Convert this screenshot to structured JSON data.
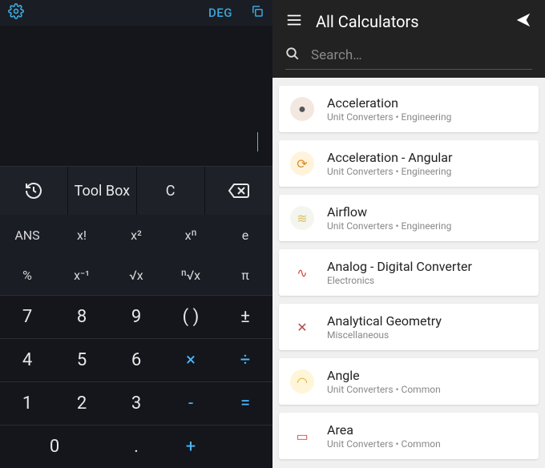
{
  "calc": {
    "mode": "DEG",
    "toolbox": "Tool Box",
    "clear": "C",
    "fn1": [
      "ANS",
      "x!",
      "x²",
      "xⁿ",
      "e"
    ],
    "fn2": [
      "%",
      "x⁻¹",
      "√x",
      "ⁿ√x",
      "π"
    ],
    "row789": [
      "7",
      "8",
      "9",
      "( )",
      "±"
    ],
    "row456": [
      "4",
      "5",
      "6",
      "×",
      "÷"
    ],
    "row123": [
      "1",
      "2",
      "3",
      "-",
      "="
    ],
    "row0": [
      "0",
      ".",
      "+"
    ]
  },
  "list": {
    "title": "All Calculators",
    "search_placeholder": "Search…",
    "items": [
      {
        "title": "Acceleration",
        "sub": "Unit Converters • Engineering",
        "icon": "●",
        "cls": "ic-accel",
        "color": "#555"
      },
      {
        "title": "Acceleration - Angular",
        "sub": "Unit Converters • Engineering",
        "icon": "⟳",
        "cls": "ic-angaccel",
        "color": "#d98c2b"
      },
      {
        "title": "Airflow",
        "sub": "Unit Converters • Engineering",
        "icon": "≋",
        "cls": "ic-airflow",
        "color": "#d4c06a"
      },
      {
        "title": "Analog - Digital Converter",
        "sub": "Electronics",
        "icon": "∿",
        "cls": "ic-analog",
        "color": "#d64545"
      },
      {
        "title": "Analytical Geometry",
        "sub": "Miscellaneous",
        "icon": "✕",
        "cls": "ic-geom",
        "color": "#b84a4a"
      },
      {
        "title": "Angle",
        "sub": "Unit Converters • Common",
        "icon": "◠",
        "cls": "ic-angle",
        "color": "#e0b030"
      },
      {
        "title": "Area",
        "sub": "Unit Converters • Common",
        "icon": "▭",
        "cls": "ic-area",
        "color": "#d64545"
      }
    ]
  }
}
